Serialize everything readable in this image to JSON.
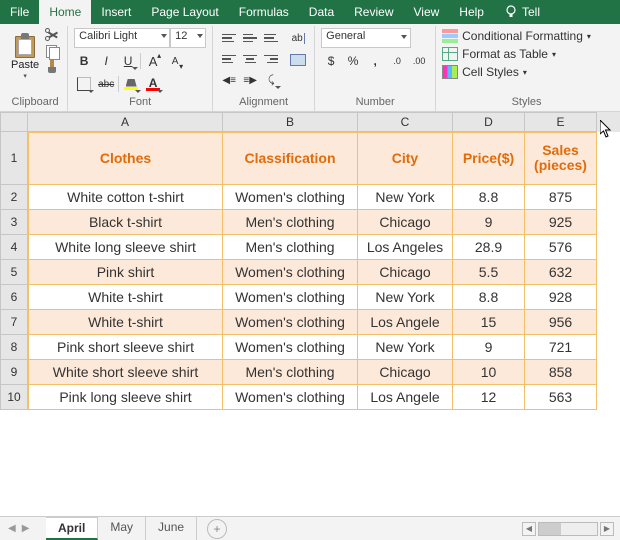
{
  "menubar": {
    "items": [
      "File",
      "Home",
      "Insert",
      "Page Layout",
      "Formulas",
      "Data",
      "Review",
      "View",
      "Help"
    ],
    "active": "Home",
    "tell": "Tell"
  },
  "ribbon": {
    "clipboard": {
      "label": "Clipboard",
      "paste": "Paste"
    },
    "font": {
      "label": "Font",
      "family": "Calibri Light",
      "size": "12",
      "bold": "B",
      "italic": "I",
      "underline": "U",
      "strike": "abc",
      "color": "A"
    },
    "alignment": {
      "label": "Alignment",
      "wrap": "ab"
    },
    "number": {
      "label": "Number",
      "format": "General",
      "currency": "$",
      "percent": "%",
      "comma": ",",
      "inc": ".0",
      "dec": ".00"
    },
    "styles": {
      "label": "Styles",
      "cf": "Conditional Formatting",
      "table": "Format as Table",
      "cells": "Cell Styles"
    }
  },
  "columns": [
    "A",
    "B",
    "C",
    "D",
    "E"
  ],
  "headers": [
    "Clothes",
    "Classification",
    "City",
    "Price($)",
    "Sales (pieces)"
  ],
  "rows": [
    {
      "n": 2,
      "clothes": "White cotton t-shirt",
      "class": "Women's clothing",
      "city": "New York",
      "price": "8.8",
      "sales": "875"
    },
    {
      "n": 3,
      "clothes": "Black t-shirt",
      "class": "Men's clothing",
      "city": "Chicago",
      "price": "9",
      "sales": "925"
    },
    {
      "n": 4,
      "clothes": "White long sleeve shirt",
      "class": "Men's clothing",
      "city": "Los Angeles",
      "price": "28.9",
      "sales": "576"
    },
    {
      "n": 5,
      "clothes": "Pink shirt",
      "class": "Women's clothing",
      "city": "Chicago",
      "price": "5.5",
      "sales": "632"
    },
    {
      "n": 6,
      "clothes": "White t-shirt",
      "class": "Women's clothing",
      "city": "New York",
      "price": "8.8",
      "sales": "928"
    },
    {
      "n": 7,
      "clothes": "White t-shirt",
      "class": "Women's clothing",
      "city": "Los Angele",
      "price": "15",
      "sales": "956"
    },
    {
      "n": 8,
      "clothes": "Pink short sleeve shirt",
      "class": "Women's clothing",
      "city": "New York",
      "price": "9",
      "sales": "721"
    },
    {
      "n": 9,
      "clothes": "White short sleeve shirt",
      "class": "Men's clothing",
      "city": "Chicago",
      "price": "10",
      "sales": "858"
    },
    {
      "n": 10,
      "clothes": "Pink long sleeve shirt",
      "class": "Women's clothing",
      "city": "Los Angele",
      "price": "12",
      "sales": "563"
    }
  ],
  "tabs": {
    "items": [
      "April",
      "May",
      "June"
    ],
    "active": "April"
  }
}
